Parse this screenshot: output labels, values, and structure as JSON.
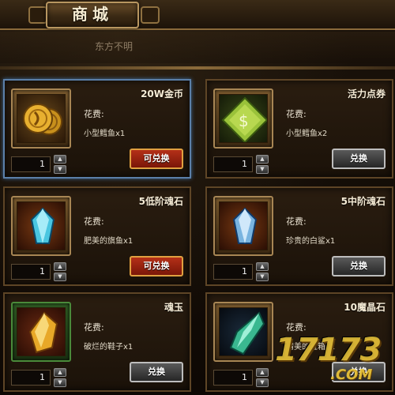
{
  "header": {
    "title": "商城",
    "subtitle": "东方不明"
  },
  "items": [
    {
      "name": "20W金币",
      "cost_label": "花费:",
      "cost_item": "小型鳕鱼x1",
      "qty": "1",
      "button": "可兑换",
      "button_state": "active",
      "icon": "gold-coins-icon"
    },
    {
      "name": "活力点券",
      "cost_label": "花费:",
      "cost_item": "小型鳕鱼x2",
      "qty": "1",
      "button": "兑换",
      "button_state": "disabled",
      "icon": "green-voucher-icon"
    },
    {
      "name": "5低阶魂石",
      "cost_label": "花费:",
      "cost_item": "肥美的旗鱼x1",
      "qty": "1",
      "button": "可兑换",
      "button_state": "active",
      "icon": "blue-soul-stone-icon"
    },
    {
      "name": "5中阶魂石",
      "cost_label": "花费:",
      "cost_item": "珍贵的白鲨x1",
      "qty": "1",
      "button": "兑换",
      "button_state": "disabled",
      "icon": "blue-soul-stone-icon"
    },
    {
      "name": "魂玉",
      "cost_label": "花费:",
      "cost_item": "破烂的鞋子x1",
      "qty": "1",
      "button": "兑换",
      "button_state": "disabled",
      "icon": "orange-soul-jade-icon"
    },
    {
      "name": "10魔晶石",
      "cost_label": "花费:",
      "cost_item": "精美的宝箱x1",
      "qty": "1",
      "button": "兑换",
      "button_state": "disabled",
      "icon": "green-magic-crystal-icon"
    }
  ],
  "watermark": {
    "main": "17173",
    "sub": ".COM"
  },
  "colors": {
    "active_button": "#b43018",
    "disabled_button": "#5a5a5a",
    "card_border": "#5e4526",
    "selected_border": "#5b7fa8",
    "gold": "#d8a428"
  }
}
